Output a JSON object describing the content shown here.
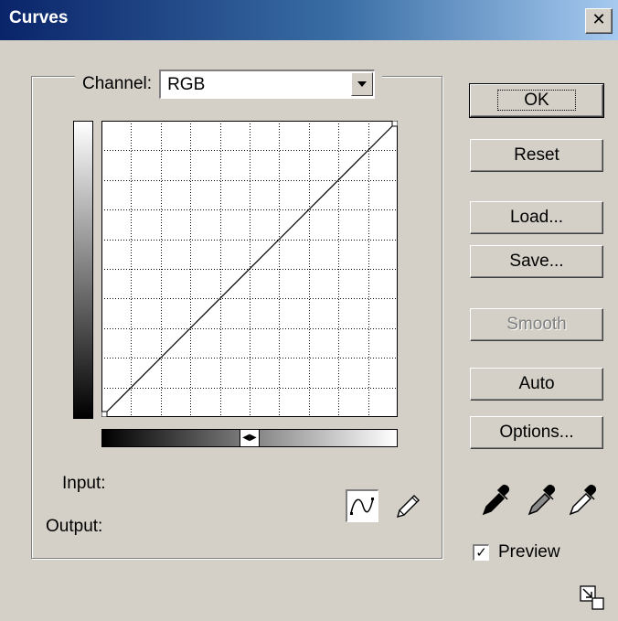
{
  "window": {
    "title": "Curves",
    "close_glyph": "✕"
  },
  "channel": {
    "label": "Channel:",
    "value": "RGB"
  },
  "graph": {
    "curve_points": [
      [
        0,
        0
      ],
      [
        255,
        255
      ]
    ]
  },
  "gradient": {
    "toggle_glyph": "◀▶"
  },
  "fields": {
    "input_label": "Input:",
    "output_label": "Output:"
  },
  "buttons": {
    "ok": "OK",
    "reset": "Reset",
    "load": "Load...",
    "save": "Save...",
    "smooth": "Smooth",
    "auto": "Auto",
    "options": "Options..."
  },
  "preview": {
    "label": "Preview",
    "checked": true,
    "check_glyph": "✓"
  },
  "icons": {
    "close": "close-icon",
    "curve_tool": "curve-tool-icon",
    "pencil_tool": "pencil-icon",
    "black_eyedropper": "black-point-eyedropper-icon",
    "gray_eyedropper": "gray-point-eyedropper-icon",
    "white_eyedropper": "white-point-eyedropper-icon",
    "resize": "expand-dialog-icon"
  }
}
